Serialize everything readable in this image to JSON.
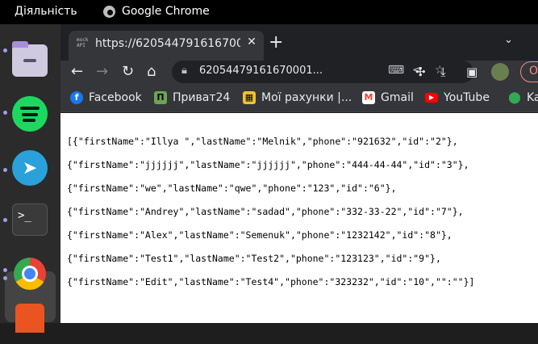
{
  "topbar": {
    "activities": "Діяльність",
    "app_name": "Google Chrome"
  },
  "dock": {
    "items": [
      "files",
      "spotify",
      "telegram",
      "terminal",
      "google-chrome",
      "app-store"
    ],
    "terminal_prompt": ">_"
  },
  "browser": {
    "tab": {
      "favicon_text": "mock API",
      "title": "https://620544791616700",
      "close": "✕"
    },
    "new_tab": "+",
    "tab_search": "⌄",
    "toolbar": {
      "back": "←",
      "forward": "→",
      "reload": "↻",
      "home": "⌂",
      "url": "62054479161670001...",
      "update_label": "Он"
    },
    "bookmarks": [
      {
        "label": "Facebook",
        "icon": "facebook-icon",
        "color": "#1877f2"
      },
      {
        "label": "Приват24",
        "icon": "privat24-icon",
        "color": "#6aa84f"
      },
      {
        "label": "Мої рахунки |...",
        "icon": "accounts-icon",
        "color": "#f1c232"
      },
      {
        "label": "Gmail",
        "icon": "gmail-icon",
        "color": "#ea4335"
      },
      {
        "label": "YouTube",
        "icon": "youtube-icon",
        "color": "#ff0000"
      },
      {
        "label": "Ka",
        "icon": "maps-icon",
        "color": "#34a853"
      }
    ]
  },
  "content": {
    "lines": [
      "[{\"firstName\":\"Illya \",\"lastName\":\"Melnik\",\"phone\":\"921632\",\"id\":\"2\"},",
      "{\"firstName\":\"jjjjjj\",\"lastName\":\"jjjjjj\",\"phone\":\"444-44-44\",\"id\":\"3\"},",
      "{\"firstName\":\"we\",\"lastName\":\"qwe\",\"phone\":\"123\",\"id\":\"6\"},",
      "{\"firstName\":\"Andrey\",\"lastName\":\"sadad\",\"phone\":\"332-33-22\",\"id\":\"7\"},",
      "{\"firstName\":\"Alex\",\"lastName\":\"Semenuk\",\"phone\":\"1232142\",\"id\":\"8\"},",
      "{\"firstName\":\"Test1\",\"lastName\":\"Test2\",\"phone\":\"123123\",\"id\":\"9\"},",
      "{\"firstName\":\"Edit\",\"lastName\":\"Test4\",\"phone\":\"323232\",\"id\":\"10\",\"\":\"\"}]"
    ]
  }
}
